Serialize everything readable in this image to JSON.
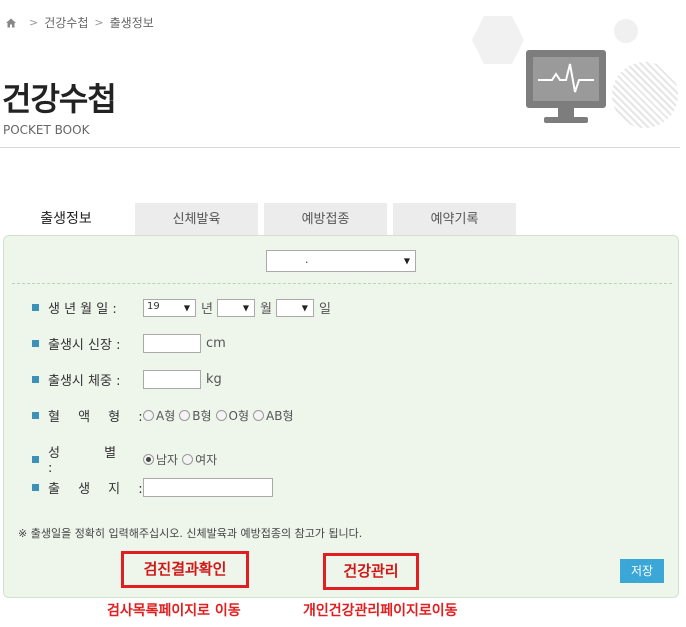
{
  "breadcrumb": {
    "items": [
      "건강수첩",
      "출생정보"
    ]
  },
  "header": {
    "title": "건강수첩",
    "subtitle": "POCKET BOOK"
  },
  "tabs": [
    {
      "label": "출생정보",
      "active": true
    },
    {
      "label": "신체발육",
      "active": false
    },
    {
      "label": "예방접종",
      "active": false
    },
    {
      "label": "예약기록",
      "active": false
    }
  ],
  "form": {
    "top_select_value": ".",
    "birthdate": {
      "label": "생 년 월 일 :",
      "year_value": "19",
      "year_unit": "년",
      "month_value": "",
      "month_unit": "월",
      "day_value": "",
      "day_unit": "일"
    },
    "height": {
      "label": "출생시 신장 :",
      "value": "",
      "unit": "cm"
    },
    "weight": {
      "label": "출생시 체중 :",
      "value": "",
      "unit": "kg"
    },
    "blood": {
      "label": "혈 액 형 :",
      "options": [
        "A형",
        "B형",
        "O형",
        "AB형"
      ],
      "selected": ""
    },
    "gender": {
      "label": "성 별 :",
      "options": [
        "남자",
        "여자"
      ],
      "selected": "남자"
    },
    "birthplace": {
      "label": "출 생 지 :",
      "value": ""
    },
    "note": "※ 출생일을 정확히 입력해주십시오. 신체발육과 예방접종의 참고가 됩니다.",
    "save_label": "저장"
  },
  "annotations": {
    "box1": "검진결과확인",
    "box2": "건강관리",
    "caption1": "검사목록페이지로 이동",
    "caption2": "개인건강관리페이지로이동"
  },
  "icons": {
    "home": "home-icon",
    "monitor": "monitor-ecg-icon",
    "accent_color": "#3aa7d6",
    "annotation_color": "#e02020"
  }
}
